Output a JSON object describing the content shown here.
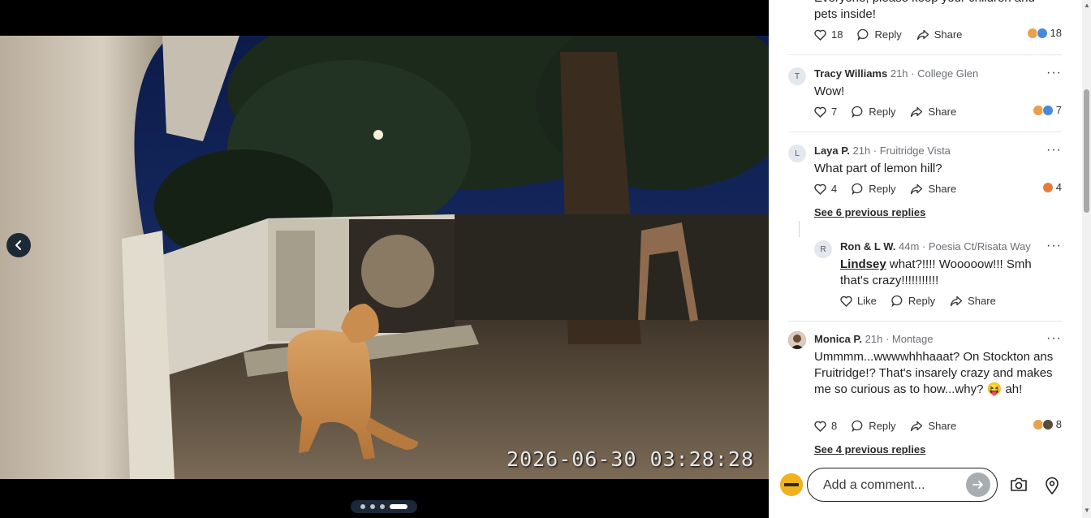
{
  "viewer": {
    "timestamp": "2026-06-30 03:28:28",
    "slide_count": 4,
    "active_slide": 4
  },
  "comments": [
    {
      "author": "",
      "meta": "",
      "body": "Everyone, please keep your children and pets inside!",
      "likes": "18",
      "reply_label": "Reply",
      "share_label": "Share",
      "reaction_count": "18"
    },
    {
      "initial": "T",
      "author": "Tracy Williams",
      "meta": "21h · College Glen",
      "body": "Wow!",
      "likes": "7",
      "reply_label": "Reply",
      "share_label": "Share",
      "reaction_count": "7"
    },
    {
      "initial": "L",
      "author": "Laya P.",
      "meta": "21h · Fruitridge Vista",
      "body": "What part of lemon hill?",
      "likes": "4",
      "reply_label": "Reply",
      "share_label": "Share",
      "reaction_count": "4",
      "see_previous": "See 6 previous replies"
    },
    {
      "initial": "R",
      "author": "Ron & L W.",
      "meta": "44m · Poesia Ct/Risata Way",
      "mention": "Lindsey",
      "body": " what?!!!! Wooooow!!! Smh that's crazy!!!!!!!!!!!",
      "like_label": "Like",
      "reply_label": "Reply",
      "share_label": "Share"
    },
    {
      "author": "Monica P.",
      "meta": "21h · Montage",
      "body": "Ummmm...wwwwhhhaaat? On Stockton ans Fruitridge!? That's insarely crazy and makes me so curious as to how...why? 😝 ah!",
      "likes": "8",
      "reply_label": "Reply",
      "share_label": "Share",
      "reaction_count": "8",
      "see_previous": "See 4 previous replies"
    }
  ],
  "composer": {
    "placeholder": "Add a comment..."
  },
  "icons": {
    "prev": "chevron-left-icon",
    "like": "heart-icon",
    "reply": "speech-bubble-icon",
    "share": "share-arrow-icon",
    "more": "more-dots-icon",
    "send": "arrow-right-icon",
    "camera": "camera-icon",
    "location": "location-pin-icon"
  },
  "colors": {
    "panel_bg": "#ffffff",
    "send_button": "#a8adb3",
    "dots_bg": "#1b2838"
  }
}
